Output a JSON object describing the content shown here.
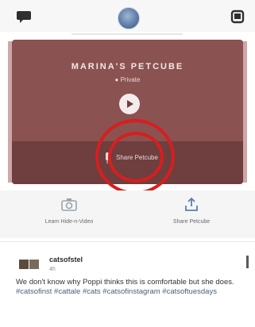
{
  "header": {
    "chat_icon": "chat-bubble-icon",
    "avatar_icon": "profile-avatar",
    "inbox_icon": "inbox-icon"
  },
  "card": {
    "title": "MARINA'S PETCUBE",
    "subtitle": "● Private",
    "play_icon": "play-icon",
    "action_label": "Share Petcube",
    "mic_icon": "microphone-icon",
    "accent_color": "#8a5250",
    "highlight_color": "#d81e1e"
  },
  "actions": [
    {
      "label": "Learn Hide-n-Video",
      "icon": "camera-icon"
    },
    {
      "label": "Share Petcube",
      "icon": "share-upload-icon"
    }
  ],
  "post": {
    "username": "catsofstel",
    "time": "4h",
    "text": "We don't know why Poppi thinks this is comfortable but she does.",
    "hashtags": "#catsofinst #cattale #cats #catsofinstagram #catsoftuesdays"
  }
}
